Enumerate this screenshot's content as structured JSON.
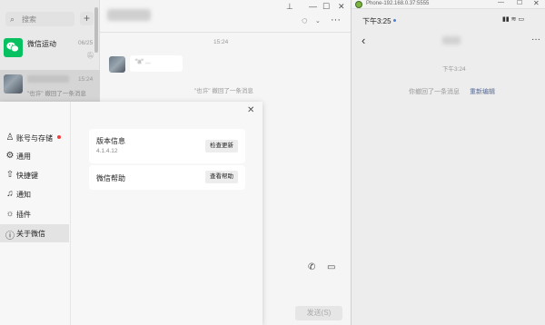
{
  "chatlist": {
    "search_placeholder": "搜索",
    "add_icon": "plus-icon",
    "items": [
      {
        "name": "微信运动",
        "time": "06/25",
        "avatar": "wechat-logo-icon"
      },
      {
        "name": "",
        "time": "15:24",
        "message": "\"也许\" 撤回了一条消息"
      }
    ]
  },
  "chat": {
    "time_divider": "15:24",
    "bubble_text": "\"a\" ...",
    "recall_notice": "\"也许\" 撤回了一条消息",
    "send_label": "发送(S)"
  },
  "dialog": {
    "nav": [
      {
        "icon": "user-icon",
        "label": "账号与存储"
      },
      {
        "icon": "gear-icon",
        "label": "通用"
      },
      {
        "icon": "shortcut-icon",
        "label": "快捷键"
      },
      {
        "icon": "bell-icon",
        "label": "通知"
      },
      {
        "icon": "plugin-icon",
        "label": "插件"
      },
      {
        "icon": "info-icon",
        "label": "关于微信"
      }
    ],
    "version_title": "版本信息",
    "version_number": "4.1.4.12",
    "check_update_label": "检查更新",
    "help_title": "微信帮助",
    "view_help_label": "查看帮助"
  },
  "phone": {
    "window_title": "Phone-192.168.0.37:5555",
    "status_time": "下午3:25",
    "status_right": "▮▮ ≋ ▭",
    "chat_time": "下午3:24",
    "recall_text": "你撤回了一条消息",
    "reedit_label": "重新编辑"
  },
  "colors": {
    "wechat_green": "#07c160",
    "link_blue": "#576b95",
    "notify_red": "#f03e3e"
  }
}
